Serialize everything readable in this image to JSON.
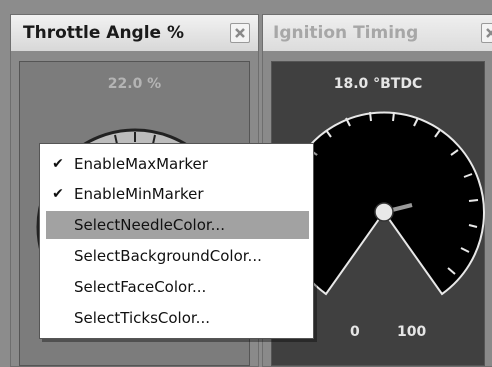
{
  "panels": [
    {
      "title": "Throttle Angle  %",
      "readout": "22.0 %",
      "gauge_value_label": "22.0 %"
    },
    {
      "title": "Ignition Timing",
      "readout": "18.0 °BTDC",
      "scale_labels": [
        "0",
        "100"
      ]
    }
  ],
  "context_menu": {
    "items": [
      {
        "label": "EnableMaxMarker",
        "checked": true
      },
      {
        "label": "EnableMinMarker",
        "checked": true
      },
      {
        "label": "SelectNeedleColor...",
        "checked": false,
        "selected": true
      },
      {
        "label": "SelectBackgroundColor...",
        "checked": false
      },
      {
        "label": "SelectFaceColor...",
        "checked": false
      },
      {
        "label": "SelectTicksColor...",
        "checked": false
      }
    ],
    "check_glyph": "✔"
  },
  "colors": {
    "selected_item_bg": "#a2a2a2",
    "gauge_face_2": "#000000",
    "panel_bg": "#8a8a8a"
  }
}
